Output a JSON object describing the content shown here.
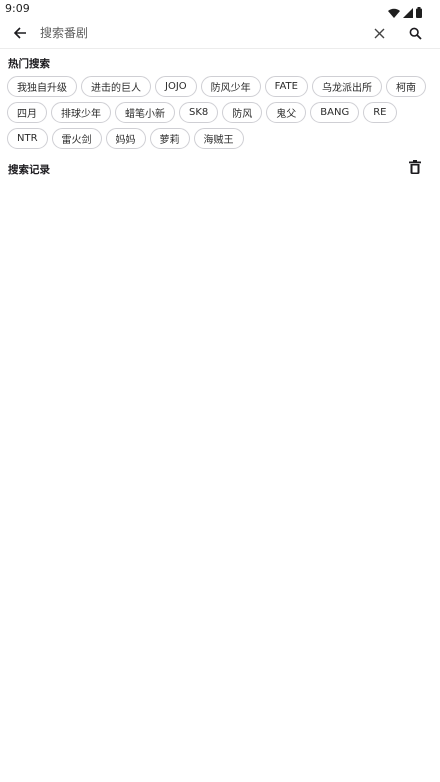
{
  "status_bar": {
    "time": "9:09",
    "icons": [
      "wifi-icon",
      "signal-icon",
      "battery-icon"
    ]
  },
  "search": {
    "placeholder": "搜索番剧",
    "value": "",
    "back_icon": "arrow-left-icon",
    "clear_icon": "close-icon",
    "search_icon": "search-icon"
  },
  "hot_search": {
    "title": "热门搜索",
    "tags": [
      "我独自升级",
      "进击的巨人",
      "JOJO",
      "防风少年",
      "FATE",
      "乌龙派出所",
      "柯南",
      "四月",
      "排球少年",
      "蜡笔小新",
      "SK8",
      "防风",
      "鬼父",
      "BANG",
      "RE",
      "NTR",
      "雷火剑",
      "妈妈",
      "萝莉",
      "海贼王"
    ]
  },
  "history": {
    "title": "搜索记录",
    "delete_icon": "trash-icon"
  },
  "colors": {
    "text": "#1c1b1f",
    "chip_border": "#cfcfd4",
    "background": "#ffffff"
  }
}
